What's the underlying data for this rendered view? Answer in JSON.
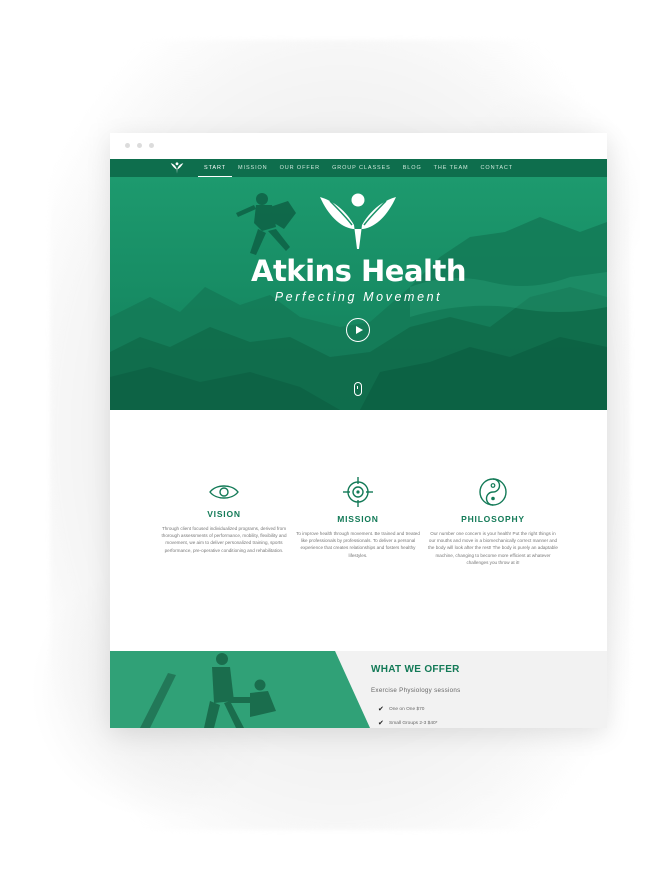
{
  "nav": {
    "items": [
      {
        "label": "START",
        "active": true
      },
      {
        "label": "MISSION",
        "active": false
      },
      {
        "label": "OUR OFFER",
        "active": false
      },
      {
        "label": "GROUP CLASSES",
        "active": false
      },
      {
        "label": "BLOG",
        "active": false
      },
      {
        "label": "THE TEAM",
        "active": false
      },
      {
        "label": "CONTACT",
        "active": false
      }
    ]
  },
  "hero": {
    "title": "Atkins Health",
    "subtitle": "Perfecting Movement",
    "play_icon": "play-icon",
    "scroll_icon": "mouse-scroll-icon"
  },
  "features": [
    {
      "icon": "eye-icon",
      "title": "VISION",
      "text": "Through client focused individualized programs, derived from thorough assessments of performance, mobility, flexibility and movement, we aim to deliver personalized training, sports performance, pre-operative conditioning and rehabilitation."
    },
    {
      "icon": "target-icon",
      "title": "MISSION",
      "text": "To improve health through movement. Be trained and treated like professionals by professionals. To deliver a personal experience that creates relationships and fosters healthy lifestyles."
    },
    {
      "icon": "yin-yang-icon",
      "title": "PHILOSOPHY",
      "text": "Our number one concern is your health! Put the right things in our mouths and move in a biomechanically correct manner and the body will look after the rest! The body is purely an adaptable machine, changing to become more efficient at whatever challenges you throw at it!"
    }
  ],
  "offer": {
    "heading": "WHAT WE OFFER",
    "subheading": "Exercise Physiology sessions",
    "items": [
      "One on One $70",
      "Small Groups 2-3 $40*"
    ]
  },
  "colors": {
    "brand_green": "#137a57",
    "nav_green": "#0e6e4d",
    "hero_green": "#1d9a6e"
  }
}
